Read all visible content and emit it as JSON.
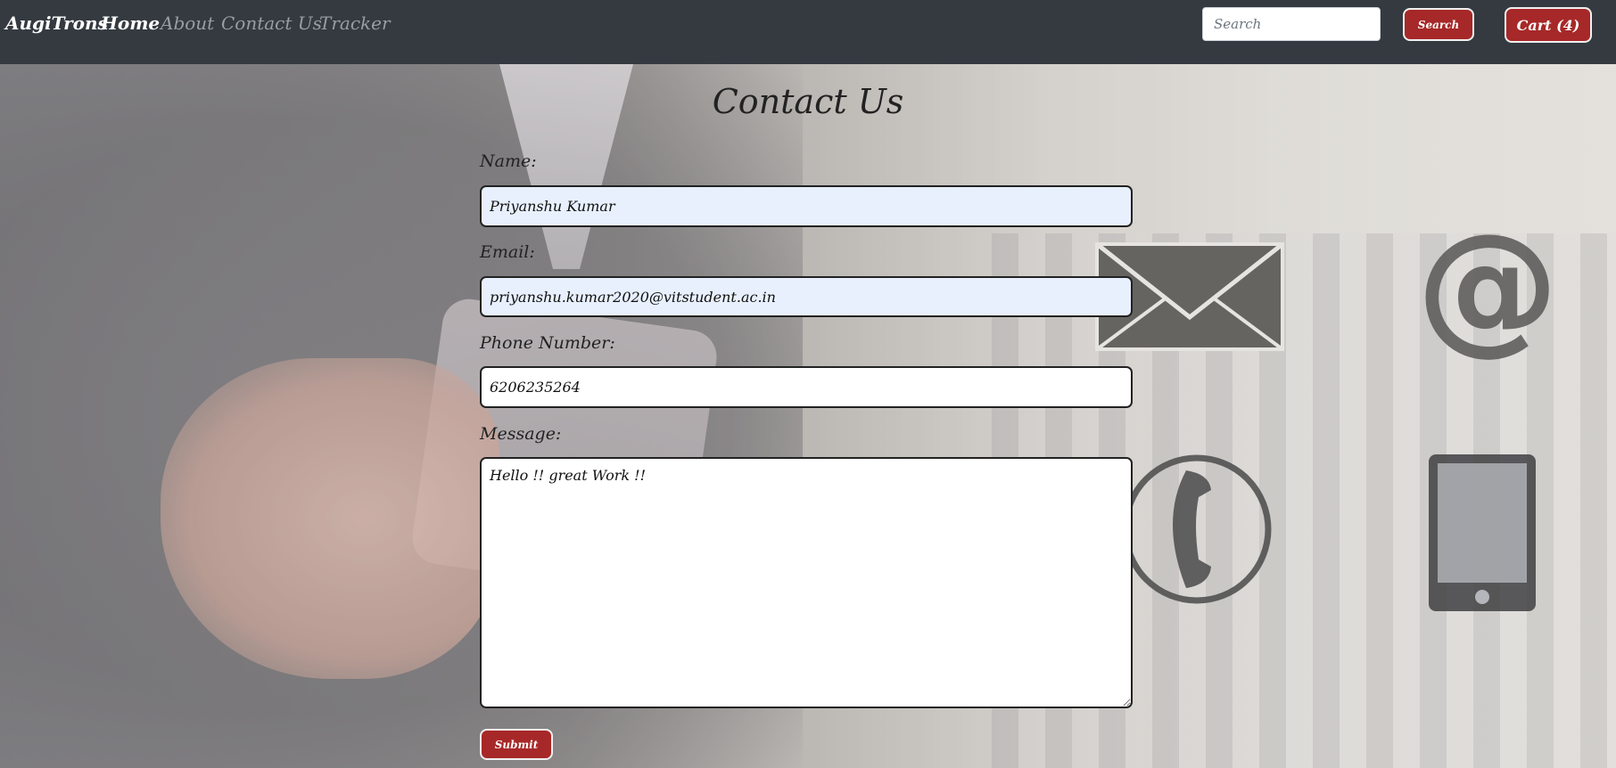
{
  "navbar": {
    "brand": "AugiTrons",
    "links": [
      {
        "label": "Home",
        "active": true
      },
      {
        "label": "About",
        "active": false
      },
      {
        "label": "Contact Us",
        "active": false
      },
      {
        "label": "Tracker",
        "active": false
      }
    ],
    "search_placeholder": "Search",
    "search_button": "Search",
    "cart_button": "Cart (4)"
  },
  "form": {
    "title": "Contact Us",
    "name_label": "Name:",
    "name_value": "Priyanshu Kumar",
    "email_label": "Email:",
    "email_value": "priyanshu.kumar2020@vitstudent.ac.in",
    "phone_label": "Phone Number:",
    "phone_value": "6206235264",
    "message_label": "Message:",
    "message_value": "Hello !! great Work !!",
    "submit_label": "Submit"
  },
  "decorations": {
    "at_symbol": "@",
    "icons": [
      "envelope-icon",
      "at-icon",
      "phone-icon",
      "tablet-icon"
    ]
  },
  "colors": {
    "navbar_bg": "#343a40",
    "button_red": "#a72828",
    "autofill_bg": "#e8f0fe"
  }
}
